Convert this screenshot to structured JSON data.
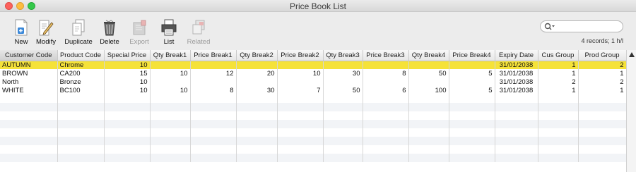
{
  "window": {
    "title": "Price Book List"
  },
  "toolbar": {
    "new": "New",
    "modify": "Modify",
    "duplicate": "Duplicate",
    "delete": "Delete",
    "export": "Export",
    "list": "List",
    "related": "Related"
  },
  "search": {
    "placeholder": "",
    "status": "4 records; 1 h/l"
  },
  "table": {
    "columns": [
      "Customer Code",
      "Product Code",
      "Special Price",
      "Qty Break1",
      "Price Break1",
      "Qty Break2",
      "Price Break2",
      "Qty Break3",
      "Price Break3",
      "Qty Break4",
      "Price Break4",
      "Expiry Date",
      "Cus Group",
      "Prod Group"
    ],
    "rows": [
      [
        "AUTUMN",
        "Chrome",
        "10",
        "",
        "",
        "",
        "",
        "",
        "",
        "",
        "",
        "31/01/2038",
        "1",
        "2"
      ],
      [
        "BROWN",
        "CA200",
        "15",
        "10",
        "12",
        "20",
        "10",
        "30",
        "8",
        "50",
        "5",
        "31/01/2038",
        "1",
        "1"
      ],
      [
        "North",
        "Bronze",
        "10",
        "",
        "",
        "",
        "",
        "",
        "",
        "",
        "",
        "31/01/2038",
        "2",
        "2"
      ],
      [
        "WHITE",
        "BC100",
        "10",
        "10",
        "8",
        "30",
        "7",
        "50",
        "6",
        "100",
        "5",
        "31/01/2038",
        "1",
        "1"
      ]
    ]
  },
  "colors": {
    "selection": "#f5e239",
    "stripe": "#f2f4f7"
  },
  "icons": [
    "new-icon",
    "modify-icon",
    "duplicate-icon",
    "delete-icon",
    "export-icon",
    "list-icon",
    "related-icon",
    "search-icon",
    "sort-up-icon"
  ]
}
